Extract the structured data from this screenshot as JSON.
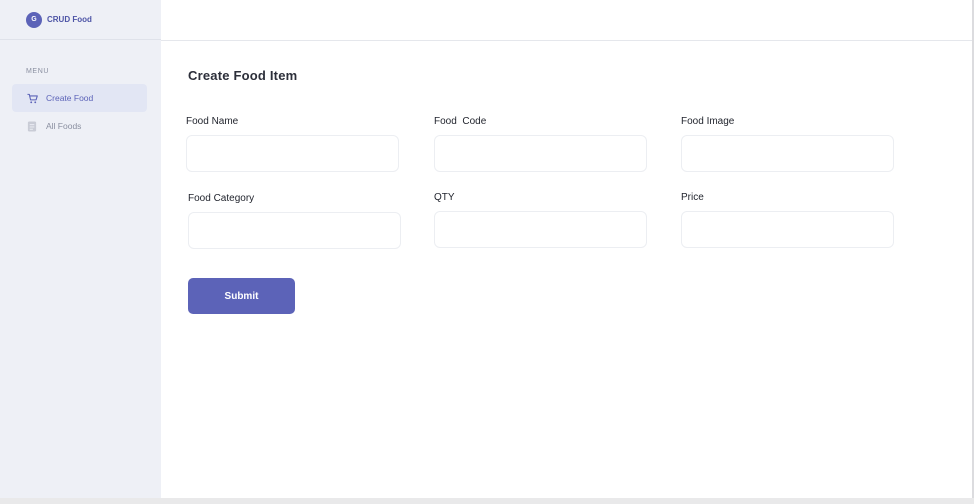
{
  "brand": {
    "logo_letter": "G",
    "name": "CRUD Food"
  },
  "sidebar": {
    "menu_label": "MENU",
    "items": [
      {
        "label": "Create Food",
        "icon": "cart-icon",
        "active": true
      },
      {
        "label": "All Foods",
        "icon": "document-icon",
        "active": false
      }
    ]
  },
  "form": {
    "title": "Create Food Item",
    "fields": [
      {
        "label": "Food Name",
        "value": ""
      },
      {
        "label": "Food  Code",
        "value": ""
      },
      {
        "label": "Food Image",
        "value": ""
      },
      {
        "label": "Food Category",
        "value": ""
      },
      {
        "label": "QTY",
        "value": ""
      },
      {
        "label": "Price",
        "value": ""
      }
    ],
    "submit_label": "Submit"
  },
  "colors": {
    "accent": "#5c63b8",
    "sidebar_bg": "#eef0f6",
    "active_item_bg": "#e2e6f4"
  }
}
